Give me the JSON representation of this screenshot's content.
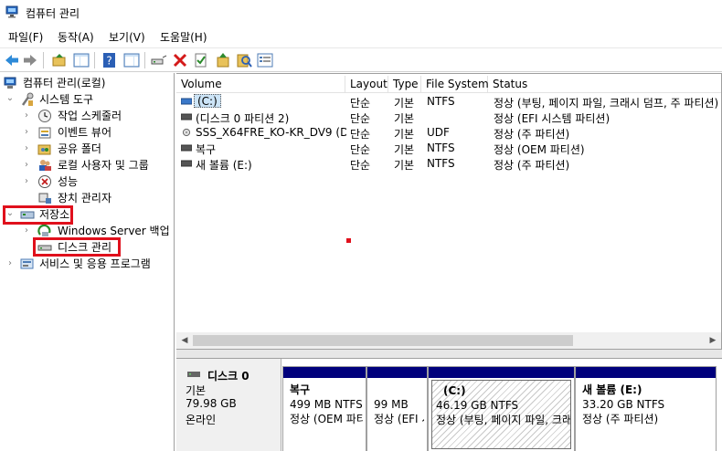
{
  "window": {
    "title": "컴퓨터 관리"
  },
  "menu": [
    {
      "label": "파일(F)"
    },
    {
      "label": "동작(A)"
    },
    {
      "label": "보기(V)"
    },
    {
      "label": "도움말(H)"
    }
  ],
  "tree": {
    "root": "컴퓨터 관리(로컬)",
    "system_tools": "시스템 도구",
    "task_scheduler": "작업 스케줄러",
    "event_viewer": "이벤트 뷰어",
    "shared_folders": "공유 폴더",
    "local_users": "로컬 사용자 및 그룹",
    "performance": "성능",
    "device_manager": "장치 관리자",
    "storage": "저장소",
    "windows_backup": "Windows Server 백업",
    "disk_management": "디스크 관리",
    "services_apps": "서비스 및 응용 프로그램"
  },
  "columns": {
    "volume": "Volume",
    "layout": "Layout",
    "type": "Type",
    "filesystem": "File System",
    "status": "Status"
  },
  "volumes": [
    {
      "name": "(C:)",
      "layout": "단순",
      "type": "기본",
      "fs": "NTFS",
      "status": "정상 (부팅, 페이지 파일, 크래시 덤프, 주 파티션)"
    },
    {
      "name": "(디스크 0 파티션 2)",
      "layout": "단순",
      "type": "기본",
      "fs": "",
      "status": "정상 (EFI 시스템 파티션)"
    },
    {
      "name": "SSS_X64FRE_KO-KR_DV9 (D:)",
      "layout": "단순",
      "type": "기본",
      "fs": "UDF",
      "status": "정상 (주 파티션)"
    },
    {
      "name": "복구",
      "layout": "단순",
      "type": "기본",
      "fs": "NTFS",
      "status": "정상 (OEM 파티션)"
    },
    {
      "name": "새 볼륨 (E:)",
      "layout": "단순",
      "type": "기본",
      "fs": "NTFS",
      "status": "정상 (주 파티션)"
    }
  ],
  "disk": {
    "name": "디스크 0",
    "type": "기본",
    "size": "79.98 GB",
    "state": "온라인",
    "partitions": [
      {
        "title": "복구",
        "size": "499 MB NTFS",
        "status": "정상 (OEM 파티션)"
      },
      {
        "title": "",
        "size": "99 MB",
        "status": "정상 (EFI 시스템 파티션)"
      },
      {
        "title": "(C:)",
        "size": "46.19 GB NTFS",
        "status": "정상 (부팅, 페이지 파일, 크래시 덤프, 주 파티션)"
      },
      {
        "title": "새 볼륨  (E:)",
        "size": "33.20 GB NTFS",
        "status": "정상 (주 파티션)"
      }
    ]
  },
  "colors": {
    "highlight": "#e0101c",
    "partition_bar": "#00007c"
  }
}
